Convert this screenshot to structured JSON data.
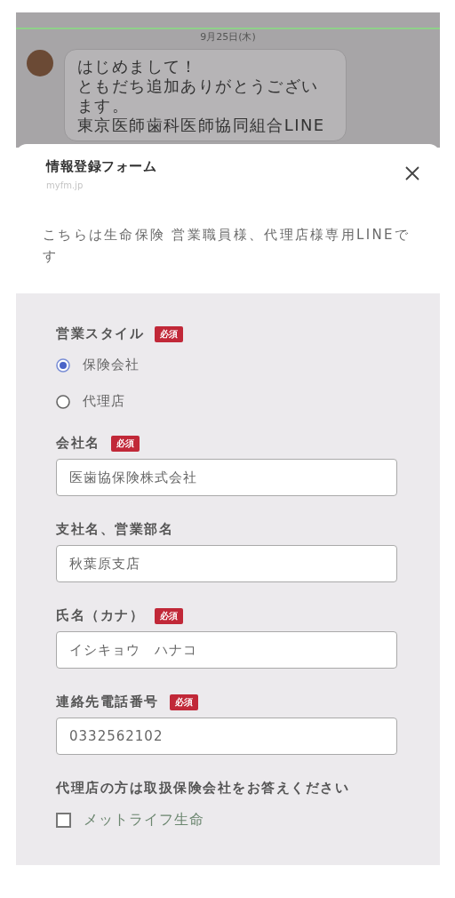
{
  "chat": {
    "date": "9月25日(木)",
    "messages": [
      {
        "paragraphs": [
          "はじめまして！",
          "ともだち追加ありがとうございます。",
          "東京医師歯科医師協同組合LINE"
        ]
      }
    ]
  },
  "sheet": {
    "title": "情報登録フォーム",
    "domain": "myfm.jp",
    "intro": "こちらは生命保険 営業職員様、代理店様専用LINEです"
  },
  "form": {
    "fields": [
      {
        "kind": "radio",
        "label": "営業スタイル",
        "badge": "必須",
        "options": [
          {
            "label": "保険会社",
            "selected": true
          },
          {
            "label": "代理店",
            "selected": false
          }
        ]
      },
      {
        "kind": "text",
        "label": "会社名",
        "badge": "必須",
        "value": "医歯協保険株式会社"
      },
      {
        "kind": "text",
        "label": "支社名、営業部名",
        "value": "秋葉原支店"
      },
      {
        "kind": "text",
        "label": "氏名（カナ）",
        "badge": "必須",
        "value": "イシキョウ　ハナコ"
      },
      {
        "kind": "text",
        "label": "連絡先電話番号",
        "badge": "必須",
        "value": "0332562102"
      },
      {
        "kind": "checkbox",
        "label": "代理店の方は取扱保険会社をお答えください",
        "options": [
          {
            "label": "メットライフ生命",
            "checked": false
          }
        ]
      }
    ]
  }
}
